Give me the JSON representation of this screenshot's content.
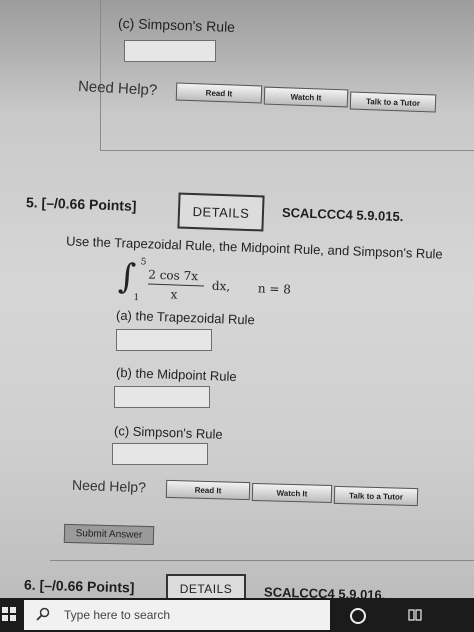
{
  "previous_problem": {
    "part_c_label": "(c) Simpson's Rule",
    "need_help": "Need Help?",
    "read_it": "Read It",
    "watch_it": "Watch It",
    "talk_to_tutor": "Talk to a Tutor"
  },
  "problem5": {
    "number_points": "5. [–/0.66 Points]",
    "details": "DETAILS",
    "code": "SCALCCC4 5.9.015.",
    "instruction": "Use the Trapezoidal Rule, the Midpoint Rule, and Simpson's Rule",
    "integral": {
      "upper": "5",
      "lower": "1",
      "numerator": "2 cos 7x",
      "denominator": "x",
      "dx": "dx,",
      "n": "n = 8"
    },
    "part_a_label": "(a) the Trapezoidal Rule",
    "part_b_label": "(b) the Midpoint Rule",
    "part_c_label": "(c) Simpson's Rule",
    "need_help": "Need Help?",
    "read_it": "Read It",
    "watch_it": "Watch It",
    "talk_to_tutor": "Talk to a Tutor",
    "submit": "Submit Answer"
  },
  "problem6": {
    "number_points": "6. [–/0.66 Points]",
    "details": "DETAILS",
    "code": "SCALCCC4 5.9.016."
  },
  "taskbar": {
    "search_placeholder": "Type here to search"
  },
  "colors": {
    "taskbar": "#1b1b1b",
    "page": "#d6d6d6",
    "search_box": "#f1f1f1"
  }
}
